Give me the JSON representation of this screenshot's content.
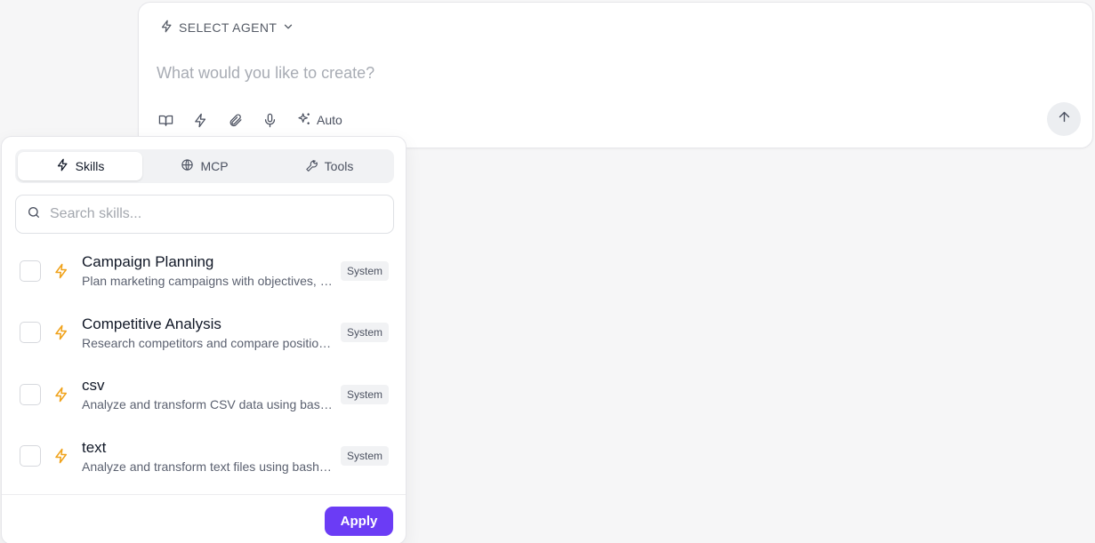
{
  "composer": {
    "agent_select_label": "SELECT AGENT",
    "prompt_placeholder": "What would you like to create?",
    "tools": {
      "book_icon": "book-open-icon",
      "skills_icon": "lightning-icon",
      "attach_icon": "paperclip-icon",
      "mic_icon": "microphone-icon",
      "auto_label": "Auto"
    },
    "send_icon": "arrow-up-icon"
  },
  "popover": {
    "tabs": [
      {
        "label": "Skills",
        "icon": "lightning-icon",
        "active": true
      },
      {
        "label": "MCP",
        "icon": "globe-icon",
        "active": false
      },
      {
        "label": "Tools",
        "icon": "wrench-icon",
        "active": false
      }
    ],
    "search_placeholder": "Search skills...",
    "skills": [
      {
        "name": "Campaign Planning",
        "description": "Plan marketing campaigns with objectives, audiences, channels and timelines",
        "badge": "System",
        "checked": false
      },
      {
        "name": "Competitive Analysis",
        "description": "Research competitors and compare positioning, pricing and features",
        "badge": "System",
        "checked": false
      },
      {
        "name": "csv",
        "description": "Analyze and transform CSV data using bash and standard tools",
        "badge": "System",
        "checked": false
      },
      {
        "name": "text",
        "description": "Analyze and transform text files using bash and standard tools",
        "badge": "System",
        "checked": false
      }
    ],
    "apply_label": "Apply"
  },
  "colors": {
    "accent": "#6b3cf5",
    "skill_icon": "#f0a21a",
    "background": "#f6f6f7"
  }
}
